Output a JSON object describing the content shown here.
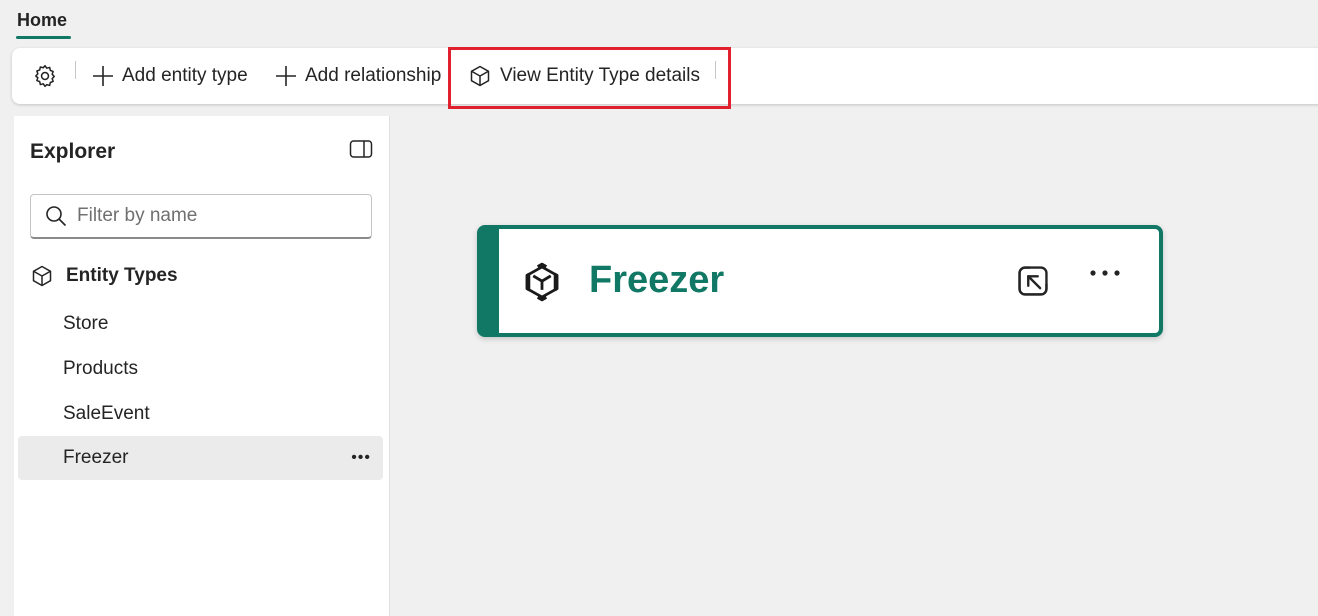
{
  "tabs": {
    "home": "Home"
  },
  "toolbar": {
    "settings_icon": "gear-icon",
    "add_entity_type": "Add entity type",
    "add_relationship": "Add relationship",
    "view_entity_type_details": "View Entity Type details"
  },
  "explorer": {
    "title": "Explorer",
    "filter_placeholder": "Filter by name",
    "section_label": "Entity Types",
    "items": [
      {
        "label": "Store"
      },
      {
        "label": "Products"
      },
      {
        "label": "SaleEvent"
      },
      {
        "label": "Freezer",
        "selected": true
      }
    ],
    "more": "•••"
  },
  "canvas": {
    "node": {
      "title": "Freezer",
      "more": "•••"
    }
  },
  "colors": {
    "accent": "#117865",
    "highlight": "#e0202e"
  }
}
